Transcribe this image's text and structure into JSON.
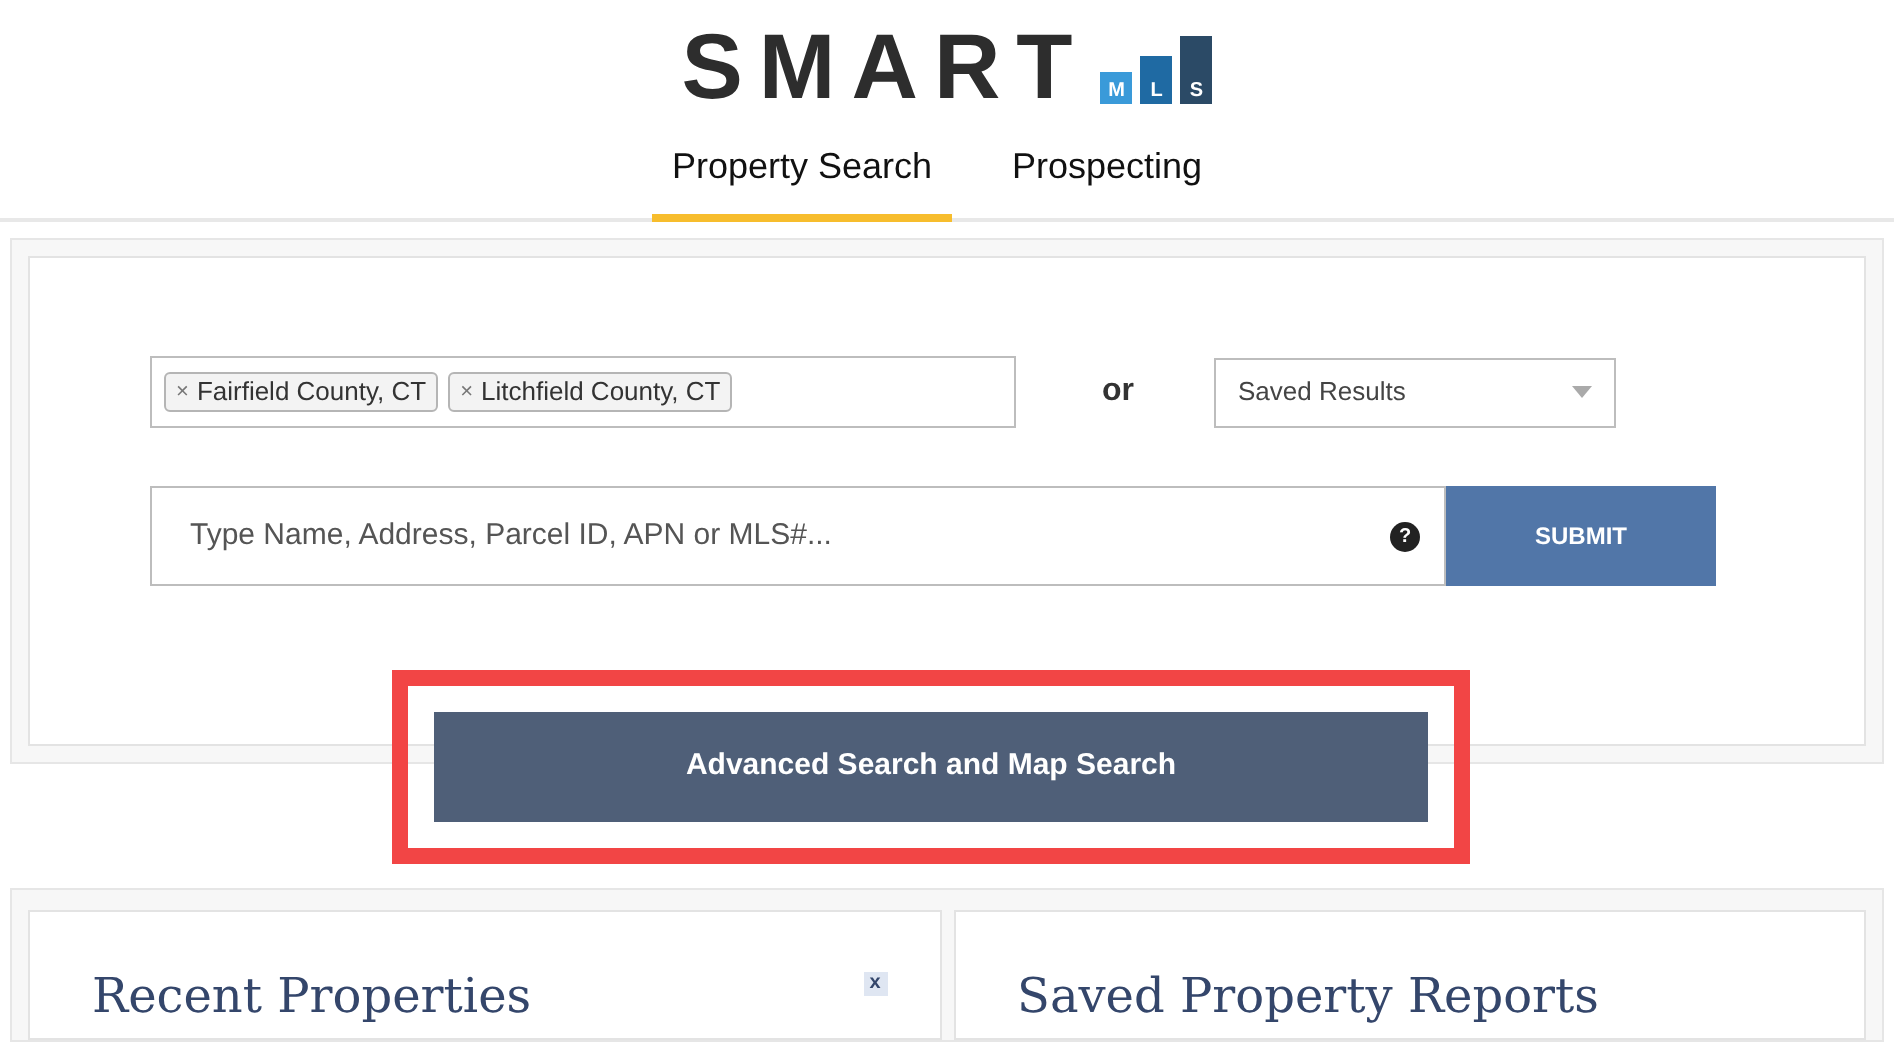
{
  "logo": {
    "wordmark": "SMART",
    "bars": [
      "M",
      "L",
      "S"
    ]
  },
  "tabs": [
    {
      "label": "Property Search",
      "selected": true
    },
    {
      "label": "Prospecting",
      "selected": false
    }
  ],
  "search": {
    "areas": [
      {
        "label": "Fairfield County, CT",
        "remove": "×"
      },
      {
        "label": "Litchfield County, CT",
        "remove": "×"
      }
    ],
    "or": "or",
    "saved_select": {
      "value": "Saved Results"
    },
    "query": {
      "placeholder": "Type Name, Address, Parcel ID, APN or MLS#..."
    },
    "help": "?",
    "submit": "SUBMIT",
    "advanced": "Advanced Search and Map Search"
  },
  "panels": [
    {
      "title": "Recent Properties",
      "close": "x"
    },
    {
      "title": "Saved Property Reports"
    }
  ]
}
